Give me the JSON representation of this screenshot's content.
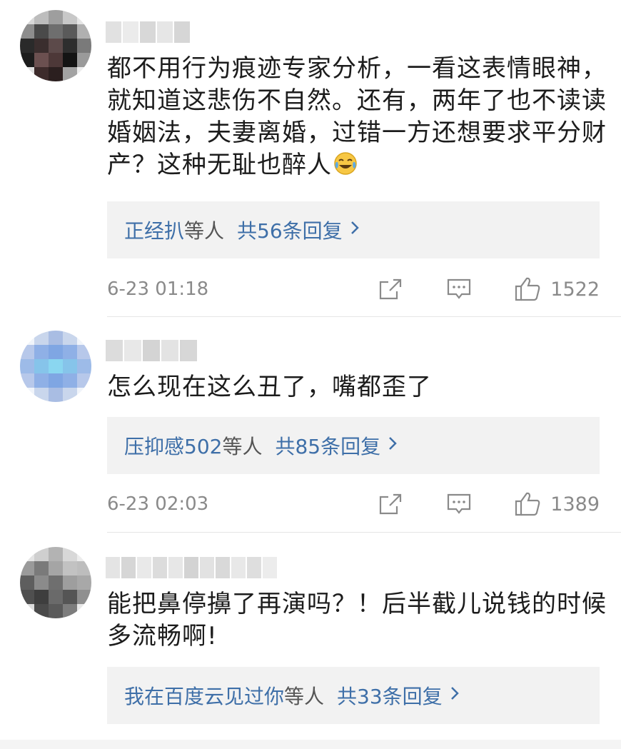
{
  "comments": [
    {
      "text": "都不用行为痕迹专家分析，一看这表情眼神，就知道这悲伤不自然。还有，两年了也不读读婚姻法，夫妻离婚，过错一方还想要求平分财产？这种无耻也醉人",
      "emoji": "laughing-crying-emoji",
      "reply_names": "正经扒",
      "reply_etc": "等人",
      "reply_total": "共56条回复",
      "time": "6-23 01:18",
      "likes": "1522"
    },
    {
      "text": "怎么现在这么丑了，嘴都歪了",
      "reply_names": "压抑感502",
      "reply_etc": "等人",
      "reply_total": "共85条回复",
      "time": "6-23 02:03",
      "likes": "1389"
    },
    {
      "text": "能把鼻停擤了再演吗？！后半截儿说钱的时候多流畅啊!",
      "reply_names": "我在百度云见过你",
      "reply_etc": "等人",
      "reply_total": "共33条回复"
    }
  ],
  "icons": {
    "share": "share-icon",
    "comment": "comment-icon",
    "like": "thumbs-up-icon",
    "chevron": "chevron-right-icon"
  },
  "colors": {
    "link": "#3e6fa8",
    "meta": "#8a8a8a",
    "reply_bg": "#f2f2f2"
  }
}
